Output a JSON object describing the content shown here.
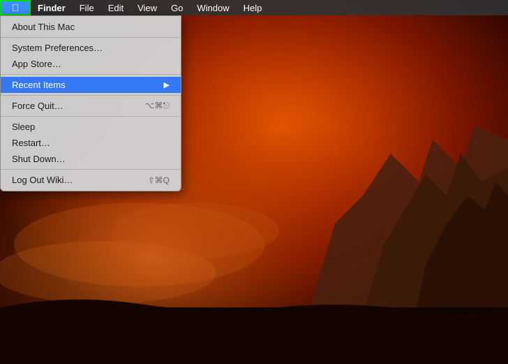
{
  "menubar": {
    "apple_label": "",
    "items": [
      {
        "label": "Finder",
        "id": "finder"
      },
      {
        "label": "File",
        "id": "file"
      },
      {
        "label": "Edit",
        "id": "edit"
      },
      {
        "label": "View",
        "id": "view"
      },
      {
        "label": "Go",
        "id": "go"
      },
      {
        "label": "Window",
        "id": "window"
      },
      {
        "label": "Help",
        "id": "help"
      }
    ]
  },
  "apple_menu": {
    "items": [
      {
        "id": "about",
        "label": "About This Mac",
        "shortcut": "",
        "arrow": false,
        "divider_after": false
      },
      {
        "id": "divider1",
        "label": "",
        "divider": true
      },
      {
        "id": "system-prefs",
        "label": "System Preferences…",
        "shortcut": "",
        "arrow": false,
        "divider_after": false
      },
      {
        "id": "app-store",
        "label": "App Store…",
        "shortcut": "",
        "arrow": false,
        "divider_after": false
      },
      {
        "id": "divider2",
        "label": "",
        "divider": true
      },
      {
        "id": "recent-items",
        "label": "Recent Items",
        "shortcut": "",
        "arrow": true,
        "divider_after": false
      },
      {
        "id": "divider3",
        "label": "",
        "divider": true
      },
      {
        "id": "force-quit",
        "label": "Force Quit…",
        "shortcut": "⌥⌘⎋",
        "arrow": false,
        "divider_after": false
      },
      {
        "id": "divider4",
        "label": "",
        "divider": true
      },
      {
        "id": "sleep",
        "label": "Sleep",
        "shortcut": "",
        "arrow": false,
        "divider_after": false
      },
      {
        "id": "restart",
        "label": "Restart…",
        "shortcut": "",
        "arrow": false,
        "divider_after": false
      },
      {
        "id": "shutdown",
        "label": "Shut Down…",
        "shortcut": "",
        "arrow": false,
        "divider_after": false
      },
      {
        "id": "divider5",
        "label": "",
        "divider": true
      },
      {
        "id": "logout",
        "label": "Log Out Wiki…",
        "shortcut": "⇧⌘Q",
        "arrow": false,
        "divider_after": false
      }
    ]
  },
  "icons": {
    "apple": "🍎",
    "submenu_arrow": "▶"
  }
}
